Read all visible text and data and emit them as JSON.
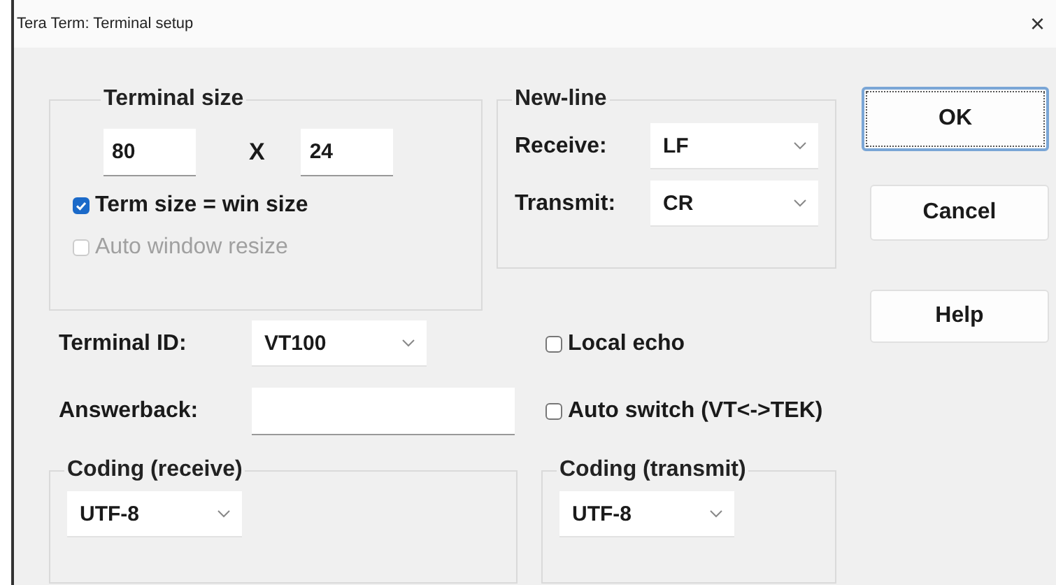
{
  "window": {
    "title": "Tera Term: Terminal setup",
    "close": "×"
  },
  "terminal_size": {
    "title": "Terminal size",
    "columns": "80",
    "separator": "X",
    "rows": "24",
    "options": [
      {
        "label": "Term size = win size",
        "checked": true,
        "disabled": false
      },
      {
        "label": "Auto window resize",
        "checked": false,
        "disabled": true
      }
    ]
  },
  "new_line": {
    "title": "New-line",
    "fields": [
      {
        "label": "Receive:",
        "value": "LF"
      },
      {
        "label": "Transmit:",
        "value": "CR"
      }
    ]
  },
  "buttons": [
    {
      "label": "OK",
      "default": true
    },
    {
      "label": "Cancel",
      "default": false
    },
    {
      "label": "Help",
      "default": false
    }
  ],
  "terminal_id": {
    "label": "Terminal ID:",
    "value": "VT100"
  },
  "answerback": {
    "label": "Answerback:"
  },
  "toggles": [
    {
      "label": "Local echo",
      "checked": false,
      "disabled": false
    },
    {
      "label": "Auto switch (VT<->TEK)",
      "checked": false,
      "disabled": false
    }
  ],
  "coding": [
    {
      "title": "Coding (receive)",
      "value": "UTF-8"
    },
    {
      "title": "Coding (transmit)",
      "value": "UTF-8"
    }
  ]
}
